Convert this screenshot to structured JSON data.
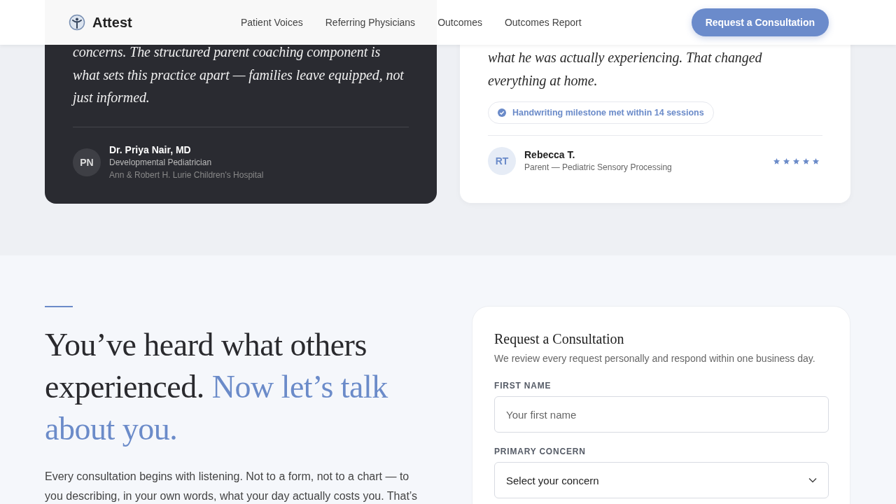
{
  "header": {
    "brand": "Attest",
    "nav": [
      {
        "label": "Patient Voices"
      },
      {
        "label": "Referring Physicians"
      },
      {
        "label": "Outcomes"
      },
      {
        "label": "Outcomes Report"
      }
    ],
    "cta": "Request a Consultation"
  },
  "testimonials": [
    {
      "kind": "dark",
      "quote": "concerns. The structured parent coaching component is what sets this practice apart — families leave equipped, not just informed.",
      "initials": "PN",
      "name": "Dr. Priya Nair, MD",
      "role": "Developmental Pediatrician",
      "affiliation": "Ann & Robert H. Lurie Children's Hospital"
    },
    {
      "kind": "light",
      "quote": "what he was actually experiencing. That changed everything at home.",
      "badge": "Handwriting milestone met within 14 sessions",
      "initials": "RT",
      "name": "Rebecca T.",
      "role": "Parent — Pediatric Sensory Processing",
      "stars": 5
    }
  ],
  "intro": {
    "heading": "You’ve heard what others experienced.",
    "heading_accent": "Now let’s talk about you.",
    "body": "Every consultation begins with listening. Not to a form, not to a chart — to you describing, in your own words, what your day actually costs you. That’s"
  },
  "form": {
    "title": "Request a Consultation",
    "subtitle": "We review every request personally and respond within one business day.",
    "fields": [
      {
        "kind": "text",
        "label": "FIRST NAME",
        "placeholder": "Your first name"
      },
      {
        "kind": "select",
        "label": "PRIMARY CONCERN",
        "value": "Select your concern"
      }
    ]
  }
}
